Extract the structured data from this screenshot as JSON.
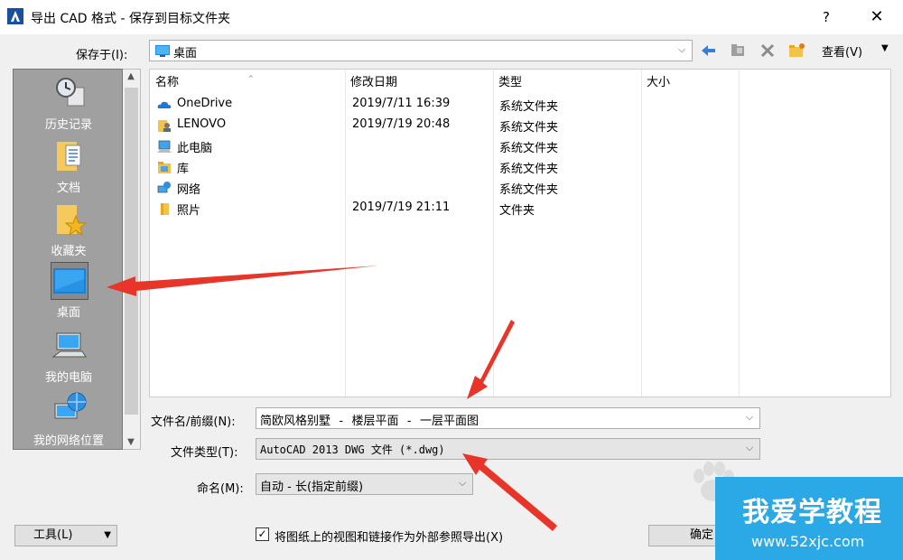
{
  "window": {
    "title": "导出 CAD 格式 - 保存到目标文件夹",
    "help": "?",
    "close": "✕"
  },
  "save_in": {
    "label": "保存于(I):",
    "value": "桌面",
    "view_label": "查看(V)"
  },
  "places": [
    {
      "label": "历史记录",
      "icon": "history-icon"
    },
    {
      "label": "文档",
      "icon": "documents-icon"
    },
    {
      "label": "收藏夹",
      "icon": "favorites-icon"
    },
    {
      "label": "桌面",
      "icon": "desktop-icon",
      "selected": true
    },
    {
      "label": "我的电脑",
      "icon": "computer-icon"
    },
    {
      "label": "我的网络位置",
      "icon": "network-icon"
    }
  ],
  "file_list": {
    "columns": [
      "名称",
      "修改日期",
      "类型",
      "大小"
    ],
    "rows": [
      {
        "name": "OneDrive",
        "date": "2019/7/11 16:39",
        "type": "系统文件夹",
        "size": "",
        "icon": "onedrive-icon"
      },
      {
        "name": "LENOVO",
        "date": "2019/7/19 20:48",
        "type": "系统文件夹",
        "size": "",
        "icon": "user-folder-icon"
      },
      {
        "name": "此电脑",
        "date": "",
        "type": "系统文件夹",
        "size": "",
        "icon": "pc-icon"
      },
      {
        "name": "库",
        "date": "",
        "type": "系统文件夹",
        "size": "",
        "icon": "library-icon"
      },
      {
        "name": "网络",
        "date": "",
        "type": "系统文件夹",
        "size": "",
        "icon": "network-icon"
      },
      {
        "name": "照片",
        "date": "2019/7/19 21:11",
        "type": "文件夹",
        "size": "",
        "icon": "folder-icon"
      }
    ]
  },
  "fields": {
    "filename_label": "文件名/前缀(N):",
    "filename_value": "简欧风格别墅 - 楼层平面 - 一层平面图",
    "filetype_label": "文件类型(T):",
    "filetype_value": "AutoCAD 2013 DWG 文件  (*.dwg)",
    "naming_label": "命名(M):",
    "naming_value": "自动 - 长(指定前缀)"
  },
  "footer": {
    "tools_label": "工具(L)",
    "checkbox_label": "将图纸上的视图和链接作为外部参照导出(X)",
    "checkbox_checked": true,
    "confirm_label": "确定"
  },
  "watermark": {
    "main": "我爱学教程",
    "sub": "www.52xjc.com"
  },
  "colors": {
    "accent_arrow": "#e8352a",
    "watermark_bg": "#2aa9e6",
    "places_bg": "#a0a0a0"
  }
}
